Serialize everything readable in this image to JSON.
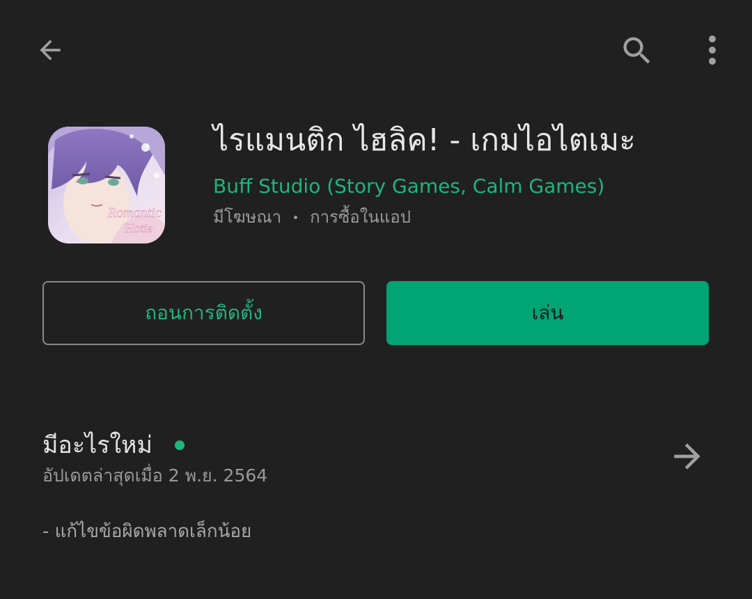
{
  "toolbar": {
    "back_icon": "arrow-back-icon",
    "search_icon": "search-icon",
    "more_icon": "more-vert-icon"
  },
  "app": {
    "icon_text_line1": "Romantic",
    "icon_text_line2": "Hotie",
    "title": "ไรแมนติก ไฮลิค! - เกมไอไตเมะ",
    "developer": "Buff Studio (Story Games, Calm Games)",
    "contains_ads": "มีโฆษณา",
    "in_app_purchases": "การซื้อในแอป"
  },
  "actions": {
    "uninstall_label": "ถอนการติดตั้ง",
    "play_label": "เล่น"
  },
  "whats_new": {
    "title": "มีอะไรใหม่",
    "updated": "อัปเดตล่าสุดเมื่อ 2 พ.ย. 2564",
    "notes": "- แก้ไขข้อผิดพลาดเล็กน้อย"
  },
  "colors": {
    "background": "#202020",
    "accent": "#01a473",
    "accent_text": "#1fb47f"
  }
}
